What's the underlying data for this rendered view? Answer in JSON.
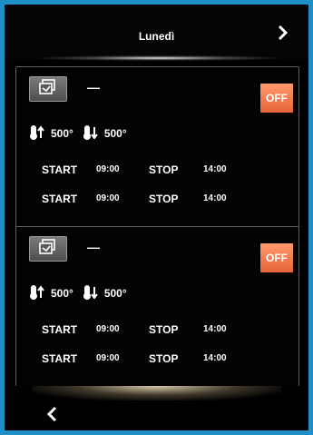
{
  "header": {
    "day_title": "Lunedì",
    "next_icon": "chevron-right-icon"
  },
  "programs": [
    {
      "icon": "program-edit-icon",
      "name": "—",
      "toggle_label": "OFF",
      "toggle_color": "#f0743f",
      "temp_up": "500°",
      "temp_down": "500°",
      "schedules": [
        {
          "start_label": "START",
          "start_time": "09:00",
          "stop_label": "STOP",
          "stop_time": "14:00"
        },
        {
          "start_label": "START",
          "start_time": "09:00",
          "stop_label": "STOP",
          "stop_time": "14:00"
        }
      ]
    },
    {
      "icon": "program-edit-icon",
      "name": "—",
      "toggle_label": "OFF",
      "toggle_color": "#f0743f",
      "temp_up": "500°",
      "temp_down": "500°",
      "schedules": [
        {
          "start_label": "START",
          "start_time": "09:00",
          "stop_label": "STOP",
          "stop_time": "14:00"
        },
        {
          "start_label": "START",
          "start_time": "09:00",
          "stop_label": "STOP",
          "stop_time": "14:00"
        }
      ]
    }
  ],
  "footer": {
    "back_icon": "chevron-left-icon"
  },
  "colors": {
    "frame_border": "#1f8fc9",
    "background": "#000000",
    "accent_off": "#f0743f"
  }
}
